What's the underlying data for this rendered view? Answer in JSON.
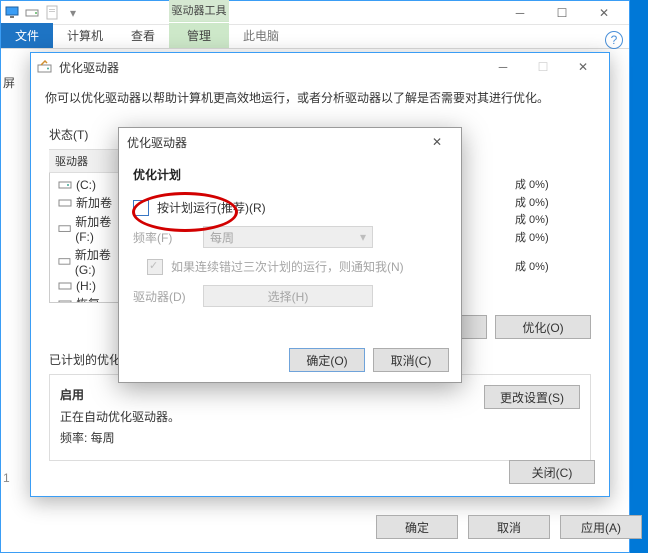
{
  "explorer": {
    "qat_down": "▾",
    "context_group": "驱动器工具",
    "location_label": "此电脑",
    "tabs": {
      "file": "文件",
      "computer": "计算机",
      "view": "查看",
      "manage": "管理"
    }
  },
  "left_stub": {
    "l1": "屏",
    "l2": "1"
  },
  "opt": {
    "title": "优化驱动器",
    "desc": "你可以优化驱动器以帮助计算机更高效地运行，或者分析驱动器以了解是否需要对其进行优化。",
    "status_label": "状态(T)",
    "drive_header": "驱动器",
    "drives": [
      {
        "name": "(C:)"
      },
      {
        "name": "新加卷"
      },
      {
        "name": "新加卷 (F:)"
      },
      {
        "name": "新加卷 (G:)"
      },
      {
        "name": "(H:)"
      },
      {
        "name": "恢复"
      }
    ],
    "peek": [
      "成 0%)",
      "成 0%)",
      "成 0%)",
      "成 0%)",
      "成 0%)"
    ],
    "analyze_btn": "",
    "optimize_btn": "优化(O)",
    "sched_heading": "已计划的优化",
    "sched_enabled": "启用",
    "sched_desc": "正在自动优化驱动器。",
    "sched_freq": "频率: 每周",
    "change_btn": "更改设置(S)",
    "close_btn": "关闭(C)"
  },
  "under": {
    "ok": "确定",
    "cancel": "取消",
    "apply": "应用(A)"
  },
  "dlg": {
    "title": "优化驱动器",
    "heading": "优化计划",
    "run_on_schedule": "按计划运行(推荐)(R)",
    "freq_label": "频率(F)",
    "freq_value": "每周",
    "notify_label": "如果连续错过三次计划的运行，则通知我(N)",
    "drives_label": "驱动器(D)",
    "choose_btn": "选择(H)",
    "ok": "确定(O)",
    "cancel": "取消(C)"
  }
}
